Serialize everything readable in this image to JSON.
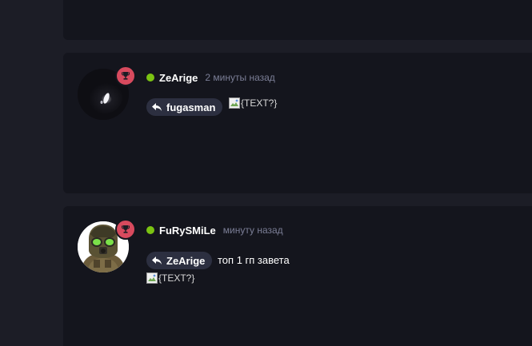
{
  "colors": {
    "online": "#7bc312",
    "badge": "#d84a5e",
    "card": "#14151d",
    "page": "#1c1d26"
  },
  "comments": [
    {
      "username": "ZeArige",
      "time": "2 минуты назад",
      "status": "online",
      "badge_icon": "trophy-icon",
      "reply_icon": "reply-arrow-icon",
      "reply_to": "fugasman",
      "text": "",
      "image_alt": "{TEXT?}"
    },
    {
      "username": "FuRySMiLe",
      "time": "минуту назад",
      "status": "online",
      "badge_icon": "trophy-icon",
      "reply_icon": "reply-arrow-icon",
      "reply_to": "ZeArige",
      "text": "топ 1 гп завета",
      "image_alt": "{TEXT?}"
    }
  ]
}
